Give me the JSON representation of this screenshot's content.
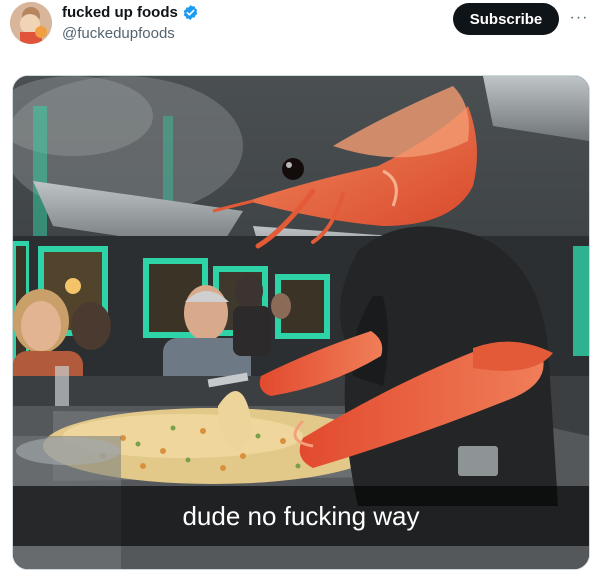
{
  "post": {
    "display_name": "fucked up foods",
    "handle": "@fuckedupfoods",
    "verified": true,
    "subscribe_label": "Subscribe",
    "more_label": "···"
  },
  "media": {
    "caption": "dude no fucking way"
  },
  "colors": {
    "subscribe_bg": "#0f1419",
    "verified_blue": "#1d9bf0",
    "shrimp": "#e8613a",
    "restaurant_teal": "#2fd3a8"
  }
}
